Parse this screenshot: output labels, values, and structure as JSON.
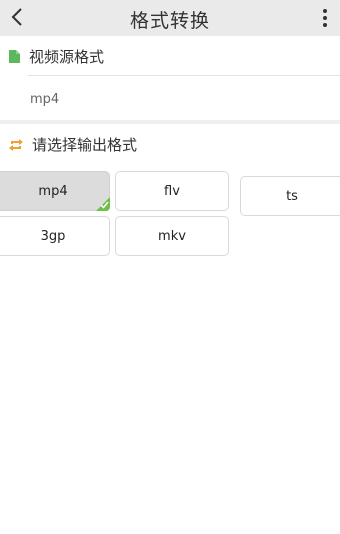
{
  "header": {
    "title": "格式转换",
    "back_icon": "chevron-left-icon",
    "menu_icon": "more-vertical-icon"
  },
  "source": {
    "title": "视频源格式",
    "icon": "document-icon",
    "icon_color": "#5cb85c",
    "value": "mp4"
  },
  "output": {
    "title": "请选择输出格式",
    "icon": "convert-icon",
    "icon_color": "#f0a030",
    "formats": [
      "mp4",
      "flv",
      "ts",
      "3gp",
      "mkv"
    ],
    "selected": "mp4"
  },
  "colors": {
    "selected_check": "#6fbf4a",
    "topbar_bg": "#eaeaea"
  }
}
